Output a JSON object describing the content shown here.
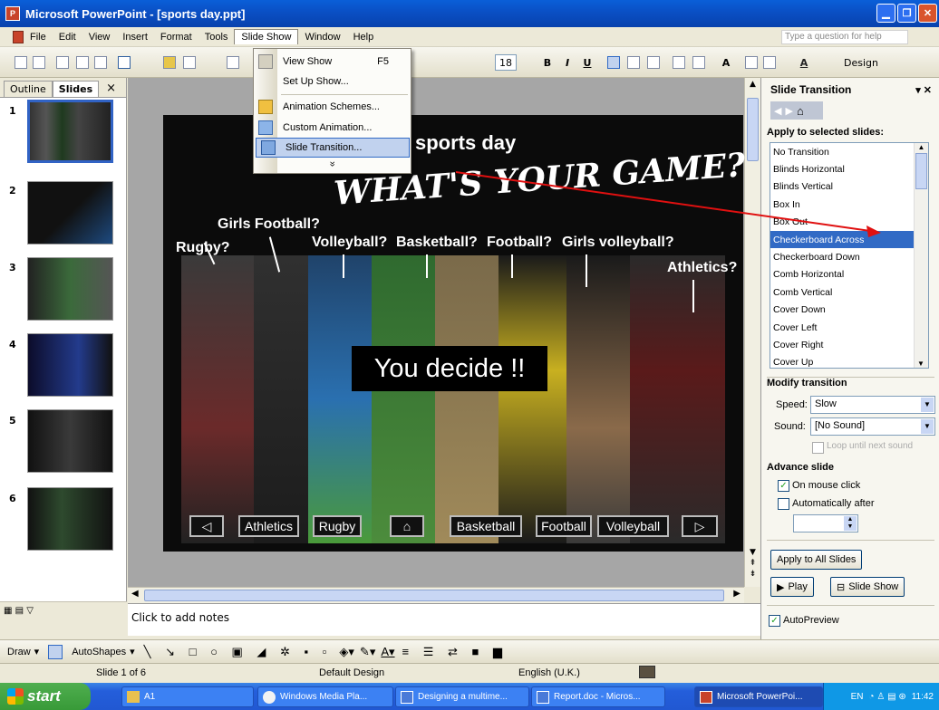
{
  "window": {
    "title": "Microsoft PowerPoint - [sports day.ppt]",
    "app_icon": "P"
  },
  "menu": {
    "items": [
      "File",
      "Edit",
      "View",
      "Insert",
      "Format",
      "Tools",
      "Slide Show",
      "Window",
      "Help"
    ],
    "help_box": "Type a question for help"
  },
  "toolbar": {
    "font_size": "18",
    "bold": "B",
    "italic": "I",
    "underline": "U",
    "design_label": "Design"
  },
  "dropdown": {
    "items": [
      {
        "label": "View Show",
        "shortcut": "F5"
      },
      {
        "label": "Set Up Show..."
      },
      {
        "label": "Animation Schemes..."
      },
      {
        "label": "Custom Animation..."
      },
      {
        "label": "Slide Transition..."
      }
    ],
    "more": "»"
  },
  "left_pane": {
    "tab_outline": "Outline",
    "tab_slides": "Slides",
    "close": "×",
    "thumb_numbers": [
      "1",
      "2",
      "3",
      "4",
      "5",
      "6"
    ]
  },
  "slide": {
    "title": "sports day",
    "subtitle": "WHAT'S YOUR GAME?",
    "labels": [
      "Girls Football?",
      "Rugby?",
      "Volleyball?",
      "Basketball?",
      "Football?",
      "Girls volleyball?",
      "Athletics?"
    ],
    "center": "You decide !!",
    "nav": [
      "Athletics",
      "Rugby",
      "Basketball",
      "Football",
      "Volleyball"
    ]
  },
  "notes": {
    "placeholder": "Click to add notes"
  },
  "task_pane": {
    "title": "Slide Transition",
    "apply_heading": "Apply to selected slides:",
    "transitions": [
      "No Transition",
      "Blinds Horizontal",
      "Blinds Vertical",
      "Box In",
      "Box Out",
      "Checkerboard Across",
      "Checkerboard Down",
      "Comb Horizontal",
      "Comb Vertical",
      "Cover Down",
      "Cover Left",
      "Cover Right",
      "Cover Up"
    ],
    "selected": "Checkerboard Across",
    "modify_heading": "Modify transition",
    "speed_label": "Speed:",
    "speed_value": "Slow",
    "sound_label": "Sound:",
    "sound_value": "[No Sound]",
    "loop_label": "Loop until next sound",
    "advance_heading": "Advance slide",
    "on_click_label": "On mouse click",
    "auto_label": "Automatically after",
    "apply_all": "Apply to All Slides",
    "play": "Play",
    "slide_show": "Slide Show",
    "autopreview": "AutoPreview"
  },
  "drawbar": {
    "draw": "Draw",
    "autoshapes": "AutoShapes"
  },
  "status": {
    "slide": "Slide 1 of 6",
    "design": "Default Design",
    "language": "English (U.K.)"
  },
  "taskbar": {
    "start": "start",
    "tasks": [
      "A1",
      "Windows Media Pla...",
      "Designing a multime...",
      "Report.doc - Micros...",
      "Microsoft PowerPoi..."
    ],
    "lang": "EN",
    "clock": "11:42"
  }
}
